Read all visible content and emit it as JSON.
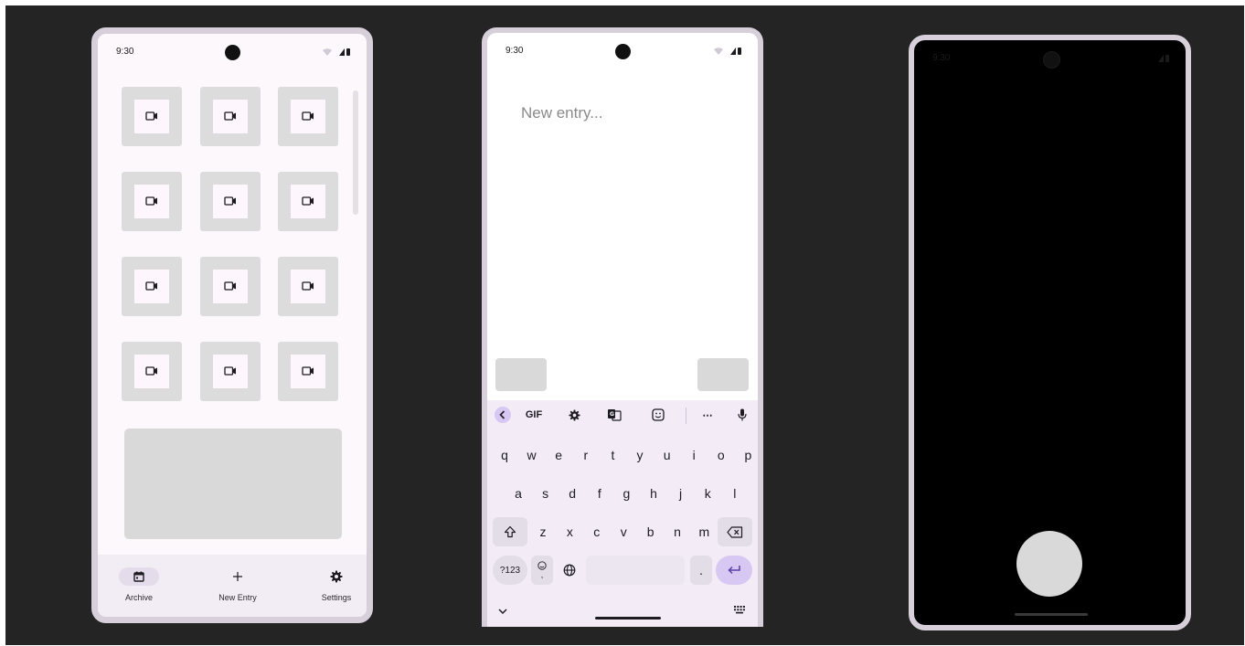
{
  "phone1": {
    "status_time": "9:30",
    "tile_icon": "video-camera-icon",
    "tiles_rows": 4,
    "tiles_cols": 3,
    "nav": [
      {
        "label": "Archive",
        "icon": "calendar-icon",
        "active": true
      },
      {
        "label": "New Entry",
        "icon": "plus-icon",
        "active": false
      },
      {
        "label": "Settings",
        "icon": "gear-icon",
        "active": false
      }
    ]
  },
  "phone2": {
    "status_time": "9:30",
    "entry_placeholder": "New entry...",
    "keyboard": {
      "toolbar": [
        "back-chevron-icon",
        "GIF",
        "gear-icon",
        "translate-icon",
        "sticker-icon",
        "more-icon",
        "mic-icon"
      ],
      "gif_label": "GIF",
      "more_label": "⋯",
      "row1": [
        "q",
        "w",
        "e",
        "r",
        "t",
        "y",
        "u",
        "i",
        "o",
        "p"
      ],
      "row2": [
        "a",
        "s",
        "d",
        "f",
        "g",
        "h",
        "j",
        "k",
        "l"
      ],
      "row3": [
        "z",
        "x",
        "c",
        "v",
        "b",
        "n",
        "m"
      ],
      "num_label": "?123",
      "comma_label": ",",
      "period_label": "."
    }
  },
  "phone3": {
    "status_time": "9:30"
  },
  "colors": {
    "background": "#242424",
    "frame": "#d7d0db",
    "placeholder_grey": "#d9d9d9",
    "accent_purple": "#d6c8f2"
  }
}
